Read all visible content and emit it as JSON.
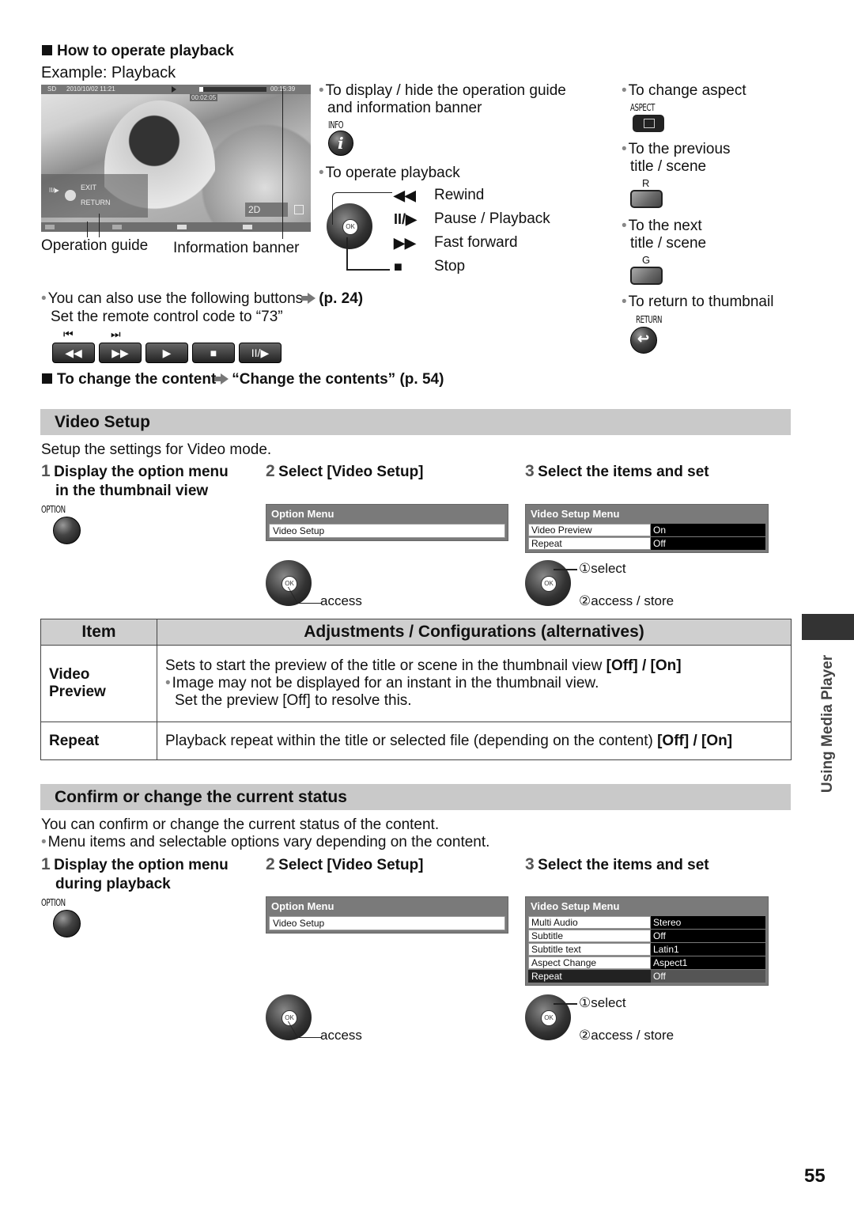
{
  "page_number": "55",
  "side_tab": {
    "label": "Using Media Player"
  },
  "how_to_operate": {
    "heading": "How to operate playback",
    "example": "Example: Playback",
    "screen": {
      "media": "SD",
      "datetime": "2010/10/02  11:21",
      "elapsed": "00:02:05",
      "total": "00:15:39",
      "guide_exit": "EXIT",
      "guide_return": "RETURN",
      "mode_badge": "2D"
    },
    "callout_operation_guide": "Operation guide",
    "callout_information_banner": "Information banner",
    "display_hide": {
      "text_line1": "To display / hide the operation guide",
      "text_line2": "and information banner",
      "button_label": "INFO"
    },
    "operate_playback": {
      "text": "To operate playback",
      "actions": [
        {
          "symbol": "◀◀",
          "label": "Rewind"
        },
        {
          "symbol": "II/▶",
          "label": "Pause / Playback"
        },
        {
          "symbol": "▶▶",
          "label": "Fast forward"
        },
        {
          "symbol": "■",
          "label": "Stop"
        }
      ],
      "ok_label": "OK"
    },
    "right_column": [
      {
        "text": "To change aspect",
        "button_label": "ASPECT",
        "button": "aspect"
      },
      {
        "text": "To the previous title / scene",
        "line1": "To the previous",
        "line2": "title / scene",
        "button_label": "R",
        "button": "red"
      },
      {
        "text": "To the next title / scene",
        "line1": "To the next",
        "line2": "title / scene",
        "button_label": "G",
        "button": "green"
      },
      {
        "text": "To return to thumbnail",
        "button_label": "RETURN",
        "button": "return"
      }
    ],
    "also_buttons": {
      "text": "You can also use the following buttons",
      "ref": "(p. 24)",
      "code_text": "Set the remote control code to “73”",
      "skip_prev": "⏮",
      "skip_next": "⏭",
      "buttons": [
        "◀◀",
        "▶▶",
        "▶",
        "■",
        "II/▶"
      ]
    },
    "change_content": {
      "text": "To change the content",
      "ref": "“Change the contents” (p. 54)"
    }
  },
  "video_setup": {
    "title": "Video Setup",
    "intro": "Setup the settings for Video mode.",
    "steps": [
      {
        "num": "1",
        "line1": "Display the option menu",
        "line2": "in the thumbnail view",
        "button_label": "OPTION"
      },
      {
        "num": "2",
        "text": "Select [Video Setup]",
        "menu_title": "Option Menu",
        "menu_item": "Video Setup",
        "nav_label": "access"
      },
      {
        "num": "3",
        "text": "Select the items and set",
        "menu_title": "Video Setup Menu",
        "rows": [
          {
            "key": "Video Preview",
            "value": "On"
          },
          {
            "key": "Repeat",
            "value": "Off"
          }
        ],
        "nav_select": "①select",
        "nav_store": "②access / store"
      }
    ]
  },
  "table": {
    "headers": [
      "Item",
      "Adjustments / Configurations (alternatives)"
    ],
    "rows": [
      {
        "item": "Video Preview",
        "item_l1": "Video",
        "item_l2": "Preview",
        "desc_main": "Sets to start the preview of the title or scene in the thumbnail view ",
        "desc_options": "[Off] / [On]",
        "desc_note": "Image may not be displayed for an instant in the thumbnail view.",
        "desc_note2": "Set the preview [Off] to resolve this."
      },
      {
        "item": "Repeat",
        "desc_main": "Playback repeat within the title or selected file (depending on the content) ",
        "desc_options": "[Off] / [On]"
      }
    ]
  },
  "confirm_status": {
    "title": "Confirm or change the current status",
    "intro": "You can confirm or change the current status of the content.",
    "note": "Menu items and selectable options vary depending on the content.",
    "steps": [
      {
        "num": "1",
        "line1": "Display the option menu",
        "line2": "during playback",
        "button_label": "OPTION"
      },
      {
        "num": "2",
        "text": "Select [Video Setup]",
        "menu_title": "Option Menu",
        "menu_item": "Video Setup",
        "nav_label": "access"
      },
      {
        "num": "3",
        "text": "Select the items and set",
        "menu_title": "Video Setup Menu",
        "rows": [
          {
            "key": "Multi Audio",
            "value": "Stereo"
          },
          {
            "key": "Subtitle",
            "value": "Off"
          },
          {
            "key": "Subtitle text",
            "value": "Latin1"
          },
          {
            "key": "Aspect Change",
            "value": "Aspect1"
          },
          {
            "key": "Repeat",
            "value": "Off",
            "selected": true
          }
        ],
        "nav_select": "①select",
        "nav_store": "②access / store"
      }
    ]
  }
}
